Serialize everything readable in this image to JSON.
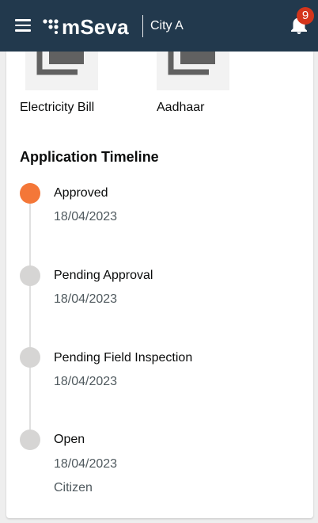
{
  "header": {
    "brand": "mSeva",
    "city": "City A",
    "notification_count": "9",
    "brand_color": "#22394d",
    "badge_color": "#d4351c"
  },
  "documents": [
    {
      "label": "Electricity Bill",
      "icon": "document-icon"
    },
    {
      "label": "Aadhaar",
      "icon": "document-icon"
    }
  ],
  "timeline": {
    "title": "Application Timeline",
    "active_color": "#f47738",
    "inactive_color": "#d6d5d4",
    "items": [
      {
        "status": "Approved",
        "date": "18/04/2023",
        "active": true
      },
      {
        "status": "Pending Approval",
        "date": "18/04/2023",
        "active": false
      },
      {
        "status": "Pending Field Inspection",
        "date": "18/04/2023",
        "active": false
      },
      {
        "status": "Open",
        "date": "18/04/2023",
        "role": "Citizen",
        "active": false
      }
    ]
  }
}
